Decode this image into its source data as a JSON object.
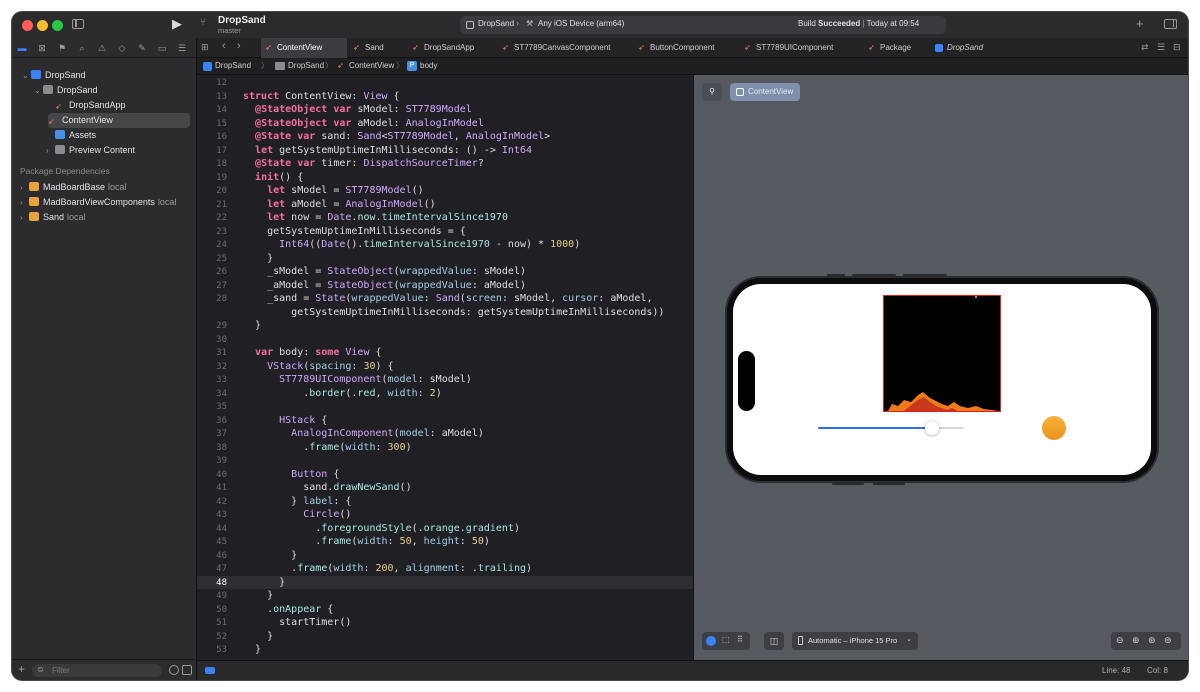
{
  "window": {
    "project_title": "DropSand",
    "branch": "master",
    "scheme_name": "DropSand",
    "destination": "Any iOS Device (arm64)",
    "build_status_prefix": "Build ",
    "build_status_bold": "Succeeded",
    "build_time": "Today at 09:54",
    "colors": {
      "close": "#ff5f57",
      "minimize": "#febc2e",
      "zoom": "#28c840",
      "accent": "#3a82f6",
      "swift": "#f0884d"
    }
  },
  "tabs": [
    {
      "label": "ContentView",
      "icon": "swift-file-icon",
      "active": true
    },
    {
      "label": "Sand",
      "icon": "swift-file-icon"
    },
    {
      "label": "DropSandApp",
      "icon": "swift-file-icon"
    },
    {
      "label": "ST7789CanvasComponent",
      "icon": "swift-file-icon"
    },
    {
      "label": "ButtonComponent",
      "icon": "swift-file-icon"
    },
    {
      "label": "ST7789UIComponent",
      "icon": "swift-file-icon"
    },
    {
      "label": "Package",
      "icon": "swift-file-icon"
    },
    {
      "label": "DropSand",
      "icon": "project-icon"
    }
  ],
  "jump_bar": [
    "DropSand",
    "DropSand",
    "ContentView",
    "body"
  ],
  "navigator": {
    "items": [
      {
        "label": "DropSand",
        "level": 0,
        "icon": "project-icon",
        "disclosure": "open"
      },
      {
        "label": "DropSand",
        "level": 1,
        "icon": "folder-icon",
        "disclosure": "open"
      },
      {
        "label": "DropSandApp",
        "level": 2,
        "icon": "swift-file-icon"
      },
      {
        "label": "ContentView",
        "level": 2,
        "icon": "swift-file-icon",
        "selected": true
      },
      {
        "label": "Assets",
        "level": 2,
        "icon": "asset-catalog-icon"
      },
      {
        "label": "Preview Content",
        "level": 2,
        "icon": "folder-icon",
        "disclosure": "closed"
      }
    ],
    "section_header": "Package Dependencies",
    "packages": [
      {
        "name": "MadBoardBase",
        "tag": "local"
      },
      {
        "name": "MadBoardViewComponents",
        "tag": "local"
      },
      {
        "name": "Sand",
        "tag": "local"
      }
    ],
    "filter_placeholder": "Filter"
  },
  "editor": {
    "current_line": 48,
    "lines": [
      {
        "n": "12",
        "code": ""
      },
      {
        "n": "13",
        "code": "struct ContentView: View {"
      },
      {
        "n": "14",
        "code": "  @StateObject var sModel: ST7789Model"
      },
      {
        "n": "15",
        "code": "  @StateObject var aModel: AnalogInModel"
      },
      {
        "n": "16",
        "code": "  @State var sand: Sand<ST7789Model, AnalogInModel>"
      },
      {
        "n": "17",
        "code": "  let getSystemUptimeInMilliseconds: () -> Int64"
      },
      {
        "n": "18",
        "code": "  @State var timer: DispatchSourceTimer?"
      },
      {
        "n": "19",
        "code": "  init() {"
      },
      {
        "n": "20",
        "code": "    let sModel = ST7789Model()"
      },
      {
        "n": "21",
        "code": "    let aModel = AnalogInModel()"
      },
      {
        "n": "22",
        "code": "    let now = Date.now.timeIntervalSince1970"
      },
      {
        "n": "23",
        "code": "    getSystemUptimeInMilliseconds = {"
      },
      {
        "n": "24",
        "code": "      Int64((Date().timeIntervalSince1970 - now) * 1000)"
      },
      {
        "n": "25",
        "code": "    }"
      },
      {
        "n": "26",
        "code": "    _sModel = StateObject(wrappedValue: sModel)"
      },
      {
        "n": "27",
        "code": "    _aModel = StateObject(wrappedValue: aModel)"
      },
      {
        "n": "28",
        "code": "    _sand = State(wrappedValue: Sand(screen: sModel, cursor: aModel,"
      },
      {
        "n": "",
        "code": "        getSystemUptimeInMilliseconds: getSystemUptimeInMilliseconds))"
      },
      {
        "n": "29",
        "code": "  }"
      },
      {
        "n": "30",
        "code": ""
      },
      {
        "n": "31",
        "code": "  var body: some View {"
      },
      {
        "n": "32",
        "code": "    VStack(spacing: 30) {"
      },
      {
        "n": "33",
        "code": "      ST7789UIComponent(model: sModel)"
      },
      {
        "n": "34",
        "code": "          .border(.red, width: 2)"
      },
      {
        "n": "35",
        "code": ""
      },
      {
        "n": "36",
        "code": "      HStack {"
      },
      {
        "n": "37",
        "code": "        AnalogInComponent(model: aModel)"
      },
      {
        "n": "38",
        "code": "          .frame(width: 300)"
      },
      {
        "n": "39",
        "code": ""
      },
      {
        "n": "40",
        "code": "        Button {"
      },
      {
        "n": "41",
        "code": "          sand.drawNewSand()"
      },
      {
        "n": "42",
        "code": "        } label: {"
      },
      {
        "n": "43",
        "code": "          Circle()"
      },
      {
        "n": "44",
        "code": "            .foregroundStyle(.orange.gradient)"
      },
      {
        "n": "45",
        "code": "            .frame(width: 50, height: 50)"
      },
      {
        "n": "46",
        "code": "        }"
      },
      {
        "n": "47",
        "code": "        .frame(width: 200, alignment: .trailing)"
      },
      {
        "n": "48",
        "code": "      }"
      },
      {
        "n": "49",
        "code": "    }"
      },
      {
        "n": "50",
        "code": "    .onAppear {"
      },
      {
        "n": "51",
        "code": "      startTimer()"
      },
      {
        "n": "52",
        "code": "    }"
      },
      {
        "n": "53",
        "code": "  }"
      }
    ]
  },
  "preview": {
    "pin_icon": "pin-icon",
    "selector_label": "ContentView",
    "device_label": "Automatic – iPhone 15 Pro",
    "slider_value": 0.78,
    "button_color": "#f0a22a",
    "screen_border_color": "#e02020"
  },
  "status_bar": {
    "line": "Line: 48",
    "col": "Col: 8"
  }
}
